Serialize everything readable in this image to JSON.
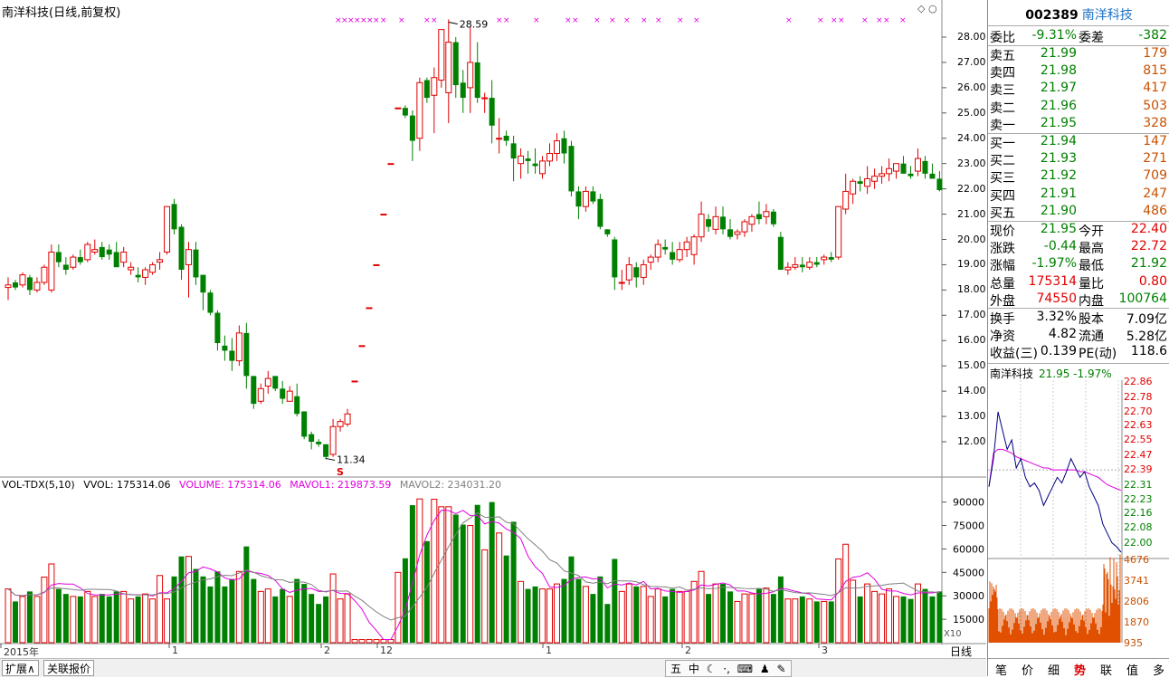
{
  "chart_title": "南洋科技(日线,前复权)",
  "tool_icons": "◇ ○",
  "price_axis_labels": [
    "28.00",
    "27.00",
    "26.00",
    "25.00",
    "24.00",
    "23.00",
    "22.00",
    "21.00",
    "20.00",
    "19.00",
    "18.00",
    "17.00",
    "16.00",
    "15.00",
    "14.00",
    "13.00",
    "12.00"
  ],
  "high_marker": "28.59",
  "low_marker": "11.34",
  "s_marker": "S",
  "volume": {
    "indicator": "VOL-TDX(5,10)",
    "vvol": "VVOL: 175314.06",
    "volume": "VOLUME: 175314.06",
    "mavol1": "MAVOL1: 219873.59",
    "mavol2": "MAVOL2: 234031.20",
    "axis_labels": [
      "90000",
      "75000",
      "60000",
      "45000",
      "30000",
      "15000"
    ],
    "multiplier": "X10"
  },
  "time_labels": [
    "2015年",
    "1",
    "2",
    "12",
    "1",
    "2",
    "3"
  ],
  "period": "日线",
  "bottom_tabs": [
    "扩展∧",
    "关联报价"
  ],
  "tray_items": [
    "五",
    "中",
    "☾",
    "·,",
    "⌨",
    "♟",
    "✎"
  ],
  "quote": {
    "code": "002389",
    "name": "南洋科技",
    "ratio_label": "委比",
    "ratio": "-9.31%",
    "diff_label": "委差",
    "diff": "-382",
    "asks": [
      {
        "label": "卖五",
        "price": "21.99",
        "vol": "179"
      },
      {
        "label": "卖四",
        "price": "21.98",
        "vol": "815"
      },
      {
        "label": "卖三",
        "price": "21.97",
        "vol": "417"
      },
      {
        "label": "卖二",
        "price": "21.96",
        "vol": "503"
      },
      {
        "label": "卖一",
        "price": "21.95",
        "vol": "328"
      }
    ],
    "bids": [
      {
        "label": "买一",
        "price": "21.94",
        "vol": "147"
      },
      {
        "label": "买二",
        "price": "21.93",
        "vol": "271"
      },
      {
        "label": "买三",
        "price": "21.92",
        "vol": "709"
      },
      {
        "label": "买四",
        "price": "21.91",
        "vol": "247"
      },
      {
        "label": "买五",
        "price": "21.90",
        "vol": "486"
      }
    ],
    "stats": [
      {
        "l1": "现价",
        "v1": "21.95",
        "l2": "今开",
        "v2": "22.40"
      },
      {
        "l1": "涨跌",
        "v1": "-0.44",
        "l2": "最高",
        "v2": "22.72"
      },
      {
        "l1": "涨幅",
        "v1": "-1.97%",
        "l2": "最低",
        "v2": "21.92"
      },
      {
        "l1": "总量",
        "v1": "175314",
        "l2": "量比",
        "v2": "0.80"
      },
      {
        "l1": "外盘",
        "v1": "74550",
        "l2": "内盘",
        "v2": "100764"
      }
    ],
    "finance": [
      {
        "l1": "换手",
        "v1": "3.32%",
        "l2": "股本",
        "v2": "7.09亿"
      },
      {
        "l1": "净资",
        "v1": "4.82",
        "l2": "流通",
        "v2": "5.28亿"
      },
      {
        "l1": "收益(三)",
        "v1": "0.139",
        "l2": "PE(动)",
        "v2": "118.6"
      }
    ]
  },
  "mini_chart": {
    "name": "南洋科技",
    "price_pct": "21.95 -1.97%",
    "price_labels": [
      "22.86",
      "22.78",
      "22.70",
      "22.63",
      "22.55",
      "22.47",
      "22.39",
      "22.31",
      "22.23",
      "22.16",
      "22.08",
      "22.00"
    ],
    "vol_labels": [
      "4676",
      "3741",
      "2806",
      "1870",
      "935"
    ]
  },
  "right_tabs": [
    "笔",
    "价",
    "细",
    "势",
    "联",
    "值",
    "多"
  ],
  "colors": {
    "up": "#e00000",
    "down": "#008000",
    "ma1": "#e000e0",
    "ma2": "#808080",
    "accent": "#1e73c8"
  },
  "chart_data": {
    "type": "candlestick",
    "candles": [
      [
        18.1,
        18.5,
        17.6,
        18.2
      ],
      [
        18.3,
        18.4,
        18.0,
        18.1
      ],
      [
        18.2,
        18.7,
        18.1,
        18.6
      ],
      [
        18.5,
        18.6,
        17.8,
        18.0
      ],
      [
        18.0,
        18.5,
        17.9,
        18.3
      ],
      [
        18.3,
        19.0,
        18.2,
        18.9
      ],
      [
        18.0,
        19.8,
        17.9,
        19.5
      ],
      [
        19.5,
        19.8,
        18.9,
        19.1
      ],
      [
        19.0,
        19.3,
        18.6,
        18.8
      ],
      [
        18.9,
        19.4,
        18.8,
        19.3
      ],
      [
        19.3,
        19.6,
        19.0,
        19.1
      ],
      [
        19.2,
        19.9,
        19.1,
        19.8
      ],
      [
        19.5,
        20.0,
        19.4,
        19.6
      ],
      [
        19.7,
        19.9,
        19.2,
        19.3
      ],
      [
        19.6,
        19.8,
        19.2,
        19.4
      ],
      [
        19.5,
        19.9,
        19.1,
        18.9
      ],
      [
        19.1,
        19.7,
        18.9,
        19.5
      ],
      [
        18.8,
        19.1,
        18.6,
        18.9
      ],
      [
        18.6,
        18.9,
        18.3,
        18.5
      ],
      [
        18.5,
        18.9,
        18.2,
        18.8
      ],
      [
        18.7,
        19.1,
        18.6,
        19.0
      ],
      [
        19.1,
        19.5,
        18.8,
        19.2
      ],
      [
        19.5,
        21.3,
        19.4,
        21.3
      ],
      [
        21.4,
        21.6,
        20.2,
        20.4
      ],
      [
        20.5,
        20.6,
        18.4,
        18.8
      ],
      [
        19.0,
        19.9,
        17.7,
        19.6
      ],
      [
        19.6,
        19.9,
        18.2,
        18.5
      ],
      [
        18.6,
        18.6,
        17.2,
        17.9
      ],
      [
        17.9,
        18.0,
        17.0,
        17.1
      ],
      [
        17.1,
        17.2,
        15.6,
        15.9
      ],
      [
        15.8,
        16.2,
        15.2,
        15.6
      ],
      [
        15.6,
        16.1,
        14.8,
        15.2
      ],
      [
        15.2,
        16.6,
        15.0,
        16.3
      ],
      [
        16.3,
        16.7,
        14.1,
        14.6
      ],
      [
        14.6,
        14.6,
        13.3,
        13.5
      ],
      [
        13.6,
        14.3,
        13.5,
        14.1
      ],
      [
        14.2,
        14.8,
        13.9,
        14.5
      ],
      [
        14.6,
        14.6,
        14.0,
        14.1
      ],
      [
        14.1,
        14.4,
        13.5,
        13.7
      ],
      [
        13.6,
        14.2,
        13.6,
        14.0
      ],
      [
        13.8,
        14.3,
        13.0,
        13.1
      ],
      [
        13.2,
        13.2,
        12.1,
        12.2
      ],
      [
        12.3,
        12.4,
        11.7,
        12.0
      ],
      [
        12.0,
        12.1,
        11.8,
        11.9
      ],
      [
        11.9,
        11.9,
        11.3,
        11.4
      ],
      [
        11.5,
        12.9,
        11.4,
        12.6
      ],
      [
        12.6,
        12.9,
        12.4,
        12.8
      ],
      [
        12.7,
        13.3,
        12.6,
        13.1
      ],
      [
        14.4,
        14.4,
        14.4,
        14.4
      ],
      [
        15.8,
        15.8,
        15.8,
        15.8
      ],
      [
        17.3,
        17.3,
        17.3,
        17.3
      ],
      [
        19.0,
        19.0,
        19.0,
        19.0
      ],
      [
        21.0,
        21.0,
        21.0,
        21.0
      ],
      [
        23.0,
        23.0,
        23.0,
        23.0
      ],
      [
        25.2,
        25.2,
        25.2,
        25.2
      ],
      [
        25.2,
        25.3,
        24.8,
        24.9
      ],
      [
        24.9,
        25.1,
        23.1,
        23.9
      ],
      [
        24.0,
        26.4,
        23.5,
        26.2
      ],
      [
        26.3,
        26.4,
        25.4,
        25.6
      ],
      [
        25.7,
        26.8,
        24.2,
        26.4
      ],
      [
        26.3,
        28.3,
        26.0,
        28.3
      ],
      [
        25.8,
        28.7,
        24.6,
        27.8
      ],
      [
        27.8,
        28.0,
        25.6,
        26.1
      ],
      [
        26.2,
        26.7,
        25.0,
        25.6
      ],
      [
        26.0,
        28.4,
        25.0,
        27.0
      ],
      [
        27.0,
        27.8,
        25.4,
        25.6
      ],
      [
        25.6,
        25.8,
        25.0,
        25.6
      ],
      [
        25.6,
        26.3,
        23.8,
        24.5
      ],
      [
        24.0,
        24.8,
        23.4,
        24.0
      ],
      [
        24.1,
        24.3,
        23.7,
        23.9
      ],
      [
        23.8,
        24.1,
        22.3,
        23.2
      ],
      [
        23.0,
        23.6,
        22.4,
        23.3
      ],
      [
        23.2,
        23.5,
        22.6,
        23.1
      ],
      [
        23.0,
        23.6,
        22.6,
        22.9
      ],
      [
        22.6,
        23.3,
        22.4,
        23.1
      ],
      [
        23.1,
        23.8,
        22.9,
        23.4
      ],
      [
        23.4,
        24.2,
        23.1,
        23.9
      ],
      [
        24.0,
        24.3,
        23.0,
        23.4
      ],
      [
        23.7,
        23.9,
        21.7,
        21.9
      ],
      [
        21.9,
        22.1,
        20.8,
        21.3
      ],
      [
        21.3,
        22.1,
        21.1,
        21.9
      ],
      [
        21.9,
        22.1,
        21.4,
        21.5
      ],
      [
        21.6,
        21.8,
        20.4,
        20.5
      ],
      [
        20.4,
        20.4,
        20.1,
        20.2
      ],
      [
        20.0,
        20.1,
        18.0,
        18.5
      ],
      [
        18.3,
        18.8,
        18.0,
        18.3
      ],
      [
        18.4,
        19.3,
        18.2,
        19.0
      ],
      [
        18.9,
        19.1,
        18.1,
        18.5
      ],
      [
        18.5,
        19.2,
        18.2,
        19.0
      ],
      [
        19.1,
        19.4,
        18.8,
        19.3
      ],
      [
        19.3,
        20.0,
        19.1,
        19.8
      ],
      [
        19.7,
        20.0,
        19.4,
        19.6
      ],
      [
        19.5,
        19.9,
        19.0,
        19.2
      ],
      [
        19.2,
        19.9,
        19.1,
        19.6
      ],
      [
        19.6,
        20.1,
        19.3,
        19.9
      ],
      [
        19.4,
        20.2,
        19.0,
        20.1
      ],
      [
        20.1,
        21.5,
        19.9,
        21.0
      ],
      [
        20.8,
        21.0,
        20.3,
        20.5
      ],
      [
        20.4,
        21.3,
        20.2,
        20.9
      ],
      [
        20.9,
        21.3,
        20.2,
        20.4
      ],
      [
        20.4,
        20.8,
        20.0,
        20.1
      ],
      [
        20.2,
        20.4,
        20.0,
        20.3
      ],
      [
        20.3,
        20.8,
        20.1,
        20.7
      ],
      [
        20.6,
        21.0,
        20.3,
        20.9
      ],
      [
        21.0,
        21.5,
        20.6,
        20.8
      ],
      [
        20.9,
        21.4,
        20.6,
        21.1
      ],
      [
        21.1,
        21.2,
        20.5,
        20.6
      ],
      [
        20.1,
        20.3,
        18.9,
        18.8
      ],
      [
        18.8,
        19.1,
        18.6,
        18.9
      ],
      [
        18.9,
        19.3,
        18.8,
        19.0
      ],
      [
        19.0,
        19.3,
        18.7,
        18.9
      ],
      [
        18.9,
        19.3,
        18.8,
        19.1
      ],
      [
        19.1,
        19.3,
        18.9,
        19.0
      ],
      [
        19.2,
        19.4,
        19.0,
        19.3
      ],
      [
        19.3,
        19.5,
        19.1,
        19.2
      ],
      [
        19.3,
        21.3,
        19.2,
        21.3
      ],
      [
        21.2,
        22.6,
        21.0,
        21.9
      ],
      [
        21.8,
        22.4,
        21.4,
        22.3
      ],
      [
        22.3,
        22.5,
        21.9,
        22.2
      ],
      [
        22.1,
        22.9,
        21.8,
        22.4
      ],
      [
        22.3,
        22.8,
        22.0,
        22.5
      ],
      [
        22.5,
        22.9,
        22.2,
        22.6
      ],
      [
        22.6,
        23.2,
        22.3,
        22.8
      ],
      [
        22.7,
        23.0,
        22.4,
        23.0
      ],
      [
        23.0,
        23.3,
        22.7,
        22.6
      ],
      [
        22.6,
        22.9,
        22.4,
        22.5
      ],
      [
        22.7,
        23.6,
        22.5,
        23.2
      ],
      [
        23.1,
        23.3,
        22.4,
        22.6
      ],
      [
        22.6,
        23.0,
        22.4,
        22.4
      ],
      [
        22.4,
        22.7,
        21.9,
        21.95
      ]
    ],
    "x_labels": [
      "2015年",
      "1",
      "2",
      "12",
      "1",
      "2",
      "3"
    ],
    "y_range": [
      11.0,
      29.0
    ],
    "legend": [
      "VOLUME",
      "MAVOL1",
      "MAVOL2"
    ]
  }
}
